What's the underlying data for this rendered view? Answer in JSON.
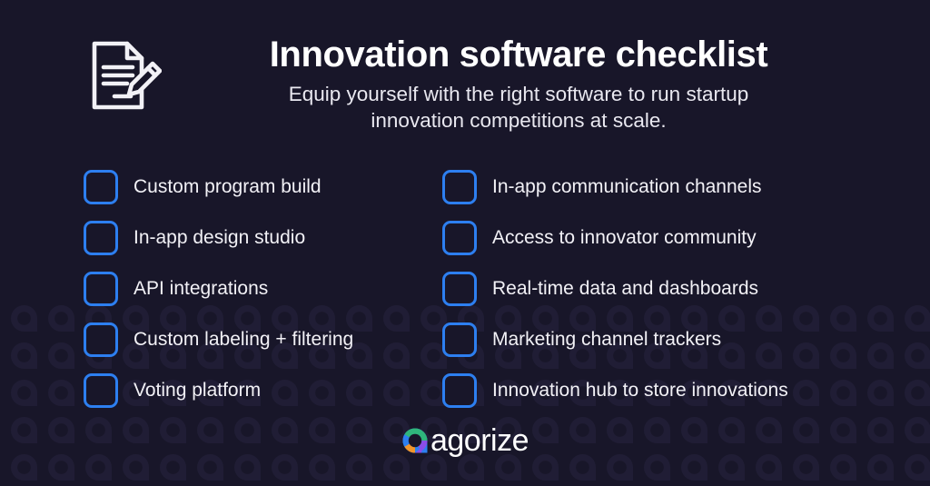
{
  "colors": {
    "background": "#181629",
    "watermark": "#201d35",
    "checkbox_border": "#2d7ff0",
    "title_text": "#ffffff",
    "subtitle_text": "#e9e8f0",
    "item_text": "#f2f1f6",
    "logo_blue": "#2d7ff0",
    "logo_green": "#2fb67c",
    "logo_orange": "#f0962d",
    "logo_purple": "#8b4de8",
    "logo_word": "#ffffff"
  },
  "header": {
    "icon": "document-pencil-icon",
    "title": "Innovation software checklist",
    "subtitle_line1": "Equip yourself with the right software to run startup",
    "subtitle_line2": "innovation competitions at scale."
  },
  "checklist": {
    "left_column": [
      {
        "label": "Custom program build",
        "checked": false
      },
      {
        "label": "In-app design studio",
        "checked": false
      },
      {
        "label": "API integrations",
        "checked": false
      },
      {
        "label": "Custom labeling + filtering",
        "checked": false
      },
      {
        "label": "Voting platform",
        "checked": false
      }
    ],
    "right_column": [
      {
        "label": "In-app communication channels",
        "checked": false
      },
      {
        "label": "Access to innovator community",
        "checked": false
      },
      {
        "label": "Real-time data and dashboards",
        "checked": false
      },
      {
        "label": "Marketing channel trackers",
        "checked": false
      },
      {
        "label": "Innovation hub to store innovations",
        "checked": false
      }
    ]
  },
  "logo": {
    "mark": "agorize-a-mark-icon",
    "wordmark": "agorize"
  },
  "watermark": {
    "glyph": "agorize-a-mark-watermark",
    "tile_size": 41
  }
}
